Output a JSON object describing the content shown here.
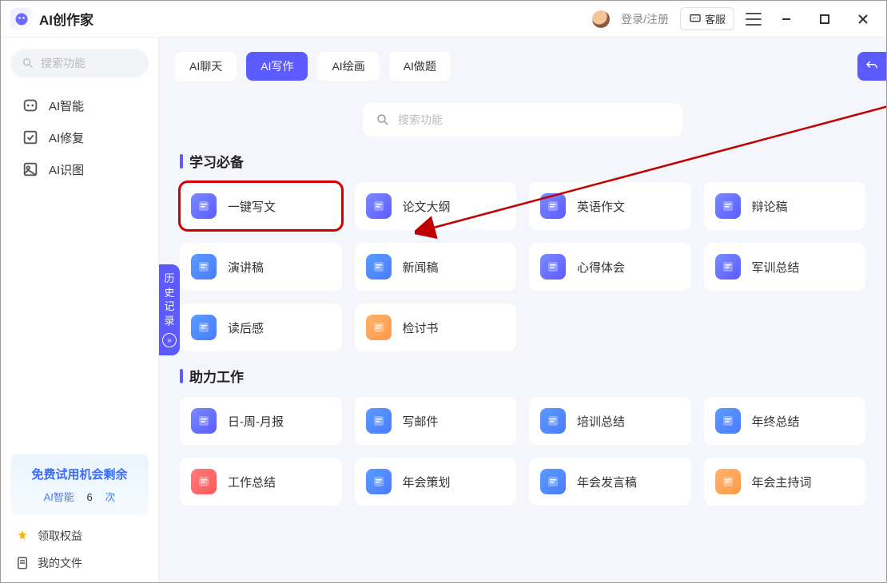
{
  "app": {
    "title": "AI创作家",
    "login": "登录/注册",
    "kefu": "客服"
  },
  "sidebar": {
    "search_placeholder": "搜索功能",
    "items": [
      {
        "label": "AI智能"
      },
      {
        "label": "AI修复"
      },
      {
        "label": "AI识图"
      }
    ],
    "trial": {
      "title": "免费试用机会剩余",
      "module": "AI智能",
      "count": "6",
      "suffix": "次"
    },
    "bottom": [
      {
        "label": "领取权益"
      },
      {
        "label": "我的文件"
      }
    ]
  },
  "tabs": [
    {
      "label": "AI聊天"
    },
    {
      "label": "AI写作"
    },
    {
      "label": "AI绘画"
    },
    {
      "label": "AI做题"
    }
  ],
  "active_tab": 1,
  "center_search_placeholder": "搜索功能",
  "history_label": "历史记录",
  "sections": [
    {
      "title": "学习必备",
      "cards": [
        {
          "label": "一键写文",
          "grad": "grad-blue",
          "highlight": true
        },
        {
          "label": "论文大纲",
          "grad": "grad-blue"
        },
        {
          "label": "英语作文",
          "grad": "grad-blue"
        },
        {
          "label": "辩论稿",
          "grad": "grad-blue"
        },
        {
          "label": "演讲稿",
          "grad": "grad-blue2"
        },
        {
          "label": "新闻稿",
          "grad": "grad-blue2"
        },
        {
          "label": "心得体会",
          "grad": "grad-blue"
        },
        {
          "label": "军训总结",
          "grad": "grad-blue"
        },
        {
          "label": "读后感",
          "grad": "grad-blue2"
        },
        {
          "label": "检讨书",
          "grad": "grad-orange"
        }
      ]
    },
    {
      "title": "助力工作",
      "cards": [
        {
          "label": "日-周-月报",
          "grad": "grad-blue"
        },
        {
          "label": "写邮件",
          "grad": "grad-blue2"
        },
        {
          "label": "培训总结",
          "grad": "grad-blue2"
        },
        {
          "label": "年终总结",
          "grad": "grad-blue2"
        },
        {
          "label": "工作总结",
          "grad": "grad-red"
        },
        {
          "label": "年会策划",
          "grad": "grad-blue2"
        },
        {
          "label": "年会发言稿",
          "grad": "grad-blue2"
        },
        {
          "label": "年会主持词",
          "grad": "grad-orange"
        }
      ]
    }
  ]
}
